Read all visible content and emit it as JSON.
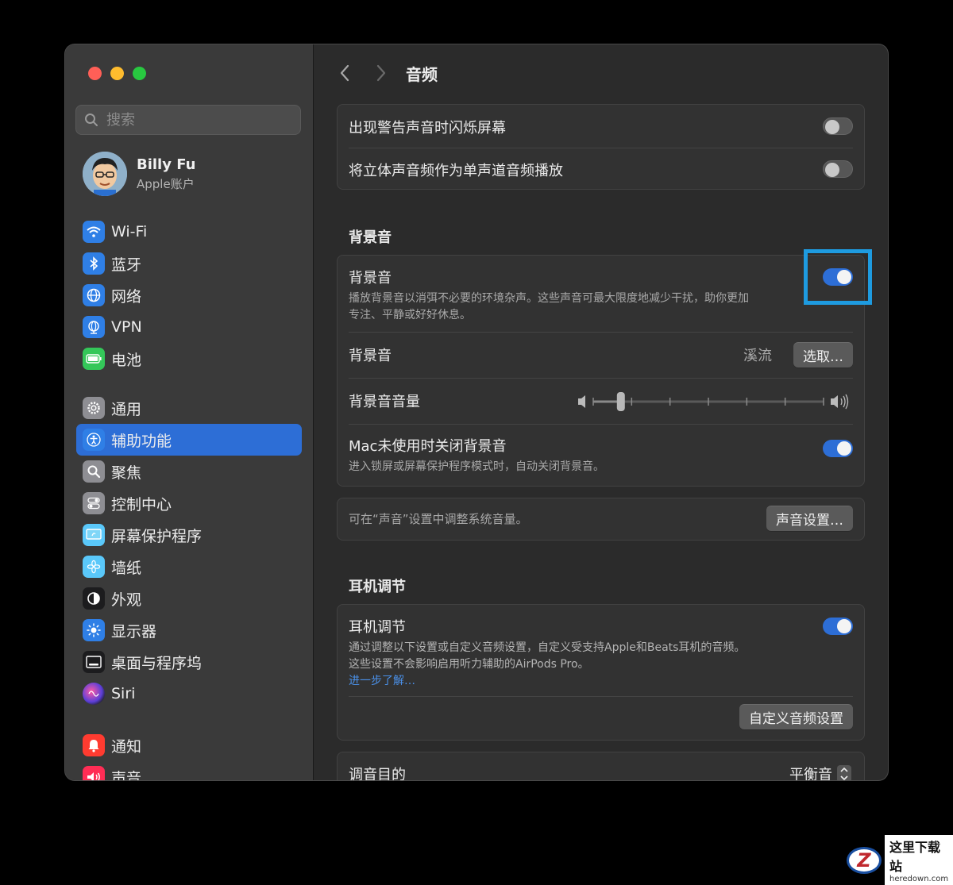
{
  "sidebar": {
    "search_placeholder": "搜索",
    "account": {
      "name": "Billy Fu",
      "subtitle": "Apple账户"
    },
    "group1": [
      {
        "label": "Wi-Fi",
        "icon": "wifi-icon",
        "color": "#2f7fe6"
      },
      {
        "label": "蓝牙",
        "icon": "bluetooth-icon",
        "color": "#2f7fe6"
      },
      {
        "label": "网络",
        "icon": "globe-icon",
        "color": "#2f7fe6"
      },
      {
        "label": "VPN",
        "icon": "vpn-globe-icon",
        "color": "#2f7fe6"
      },
      {
        "label": "电池",
        "icon": "battery-icon",
        "color": "#34c759"
      }
    ],
    "group2": [
      {
        "label": "通用",
        "icon": "gear-icon",
        "color": "#8e8e93"
      },
      {
        "label": "辅助功能",
        "icon": "accessibility-icon",
        "color": "#2f7fe6",
        "active": true
      },
      {
        "label": "聚焦",
        "icon": "magnifier-icon",
        "color": "#8e8e93"
      },
      {
        "label": "控制中心",
        "icon": "control-center-icon",
        "color": "#8e8e93"
      },
      {
        "label": "屏幕保护程序",
        "icon": "screensaver-icon",
        "color": "#5ac8fa"
      },
      {
        "label": "墙纸",
        "icon": "wallpaper-flower-icon",
        "color": "#5ac8fa"
      },
      {
        "label": "外观",
        "icon": "appearance-icon",
        "color": "#1c1c1e"
      },
      {
        "label": "显示器",
        "icon": "display-sun-icon",
        "color": "#2f7fe6"
      },
      {
        "label": "桌面与程序坞",
        "icon": "dock-icon",
        "color": "#1c1c1e"
      },
      {
        "label": "Siri",
        "icon": "siri-icon",
        "color": "#6a3fd8"
      }
    ],
    "group3": [
      {
        "label": "通知",
        "icon": "bell-icon",
        "color": "#ff3b30"
      },
      {
        "label": "声音",
        "icon": "speaker-icon",
        "color": "#ff2d55"
      }
    ]
  },
  "main": {
    "title": "音频",
    "card1": [
      {
        "label": "出现警告声音时闪烁屏幕",
        "toggle": false
      },
      {
        "label": "将立体声音频作为单声道音频播放",
        "toggle": false
      }
    ],
    "bg_section": "背景音",
    "bg_toggle": {
      "label": "背景音",
      "desc_line1": "播放背景音以消弭不必要的环境杂声。这些声音可最大限度地减少干扰，助你更加",
      "desc_line2": "专注、平静或好好休息。",
      "toggle": true
    },
    "bg_sound": {
      "label": "背景音",
      "value": "溪流",
      "button": "选取…"
    },
    "bg_volume": {
      "label": "背景音音量",
      "level": 0.12,
      "ticks": 7
    },
    "bg_off": {
      "label": "Mac未使用时关闭背景音",
      "desc": "进入锁屏或屏幕保护程序模式时，自动关闭背景音。",
      "toggle": true
    },
    "sound_note": {
      "text": "可在“声音”设置中调整系统音量。",
      "button": "声音设置…"
    },
    "hp_section": "耳机调节",
    "hp": {
      "label": "耳机调节",
      "desc_line1": "通过调整以下设置或自定义音频设置，自定义受支持Apple和Beats耳机的音频。",
      "desc_line2": "这些设置不会影响启用听力辅助的AirPods Pro。",
      "link": "进一步了解…",
      "toggle": true,
      "custom_button": "自定义音频设置"
    },
    "tune": {
      "label": "调音目的",
      "value": "平衡音"
    }
  },
  "watermark": {
    "logo": "Z",
    "text": "这里下载站",
    "url": "heredown.com"
  }
}
